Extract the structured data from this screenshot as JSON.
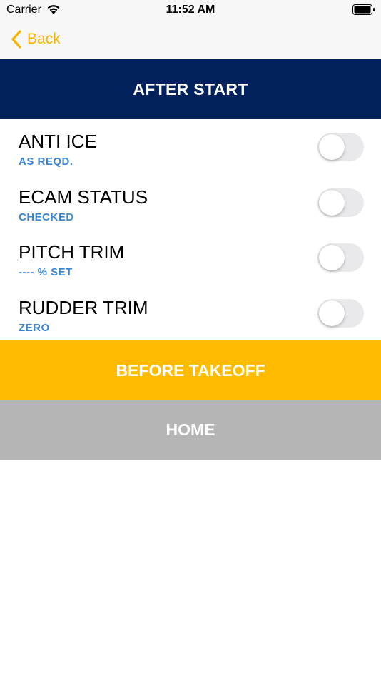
{
  "status_bar": {
    "carrier": "Carrier",
    "time": "11:52 AM",
    "icons": [
      "wifi-icon",
      "battery-icon"
    ]
  },
  "nav": {
    "back_label": "Back",
    "accent_color": "#f4b400"
  },
  "section": {
    "title": "AFTER START",
    "color": "#00215c"
  },
  "checklist": {
    "items": [
      {
        "title": "ANTI ICE",
        "action": "AS REQD.",
        "checked": false
      },
      {
        "title": "ECAM STATUS",
        "action": "CHECKED",
        "checked": false
      },
      {
        "title": "PITCH TRIM",
        "action": "---- % SET",
        "checked": false
      },
      {
        "title": "RUDDER TRIM",
        "action": "ZERO",
        "checked": false
      }
    ],
    "action_color": "#3a86d4"
  },
  "buttons": {
    "next_label": "BEFORE TAKEOFF",
    "next_color": "#ffbb00",
    "home_label": "HOME",
    "home_color": "#b5b5b5"
  }
}
